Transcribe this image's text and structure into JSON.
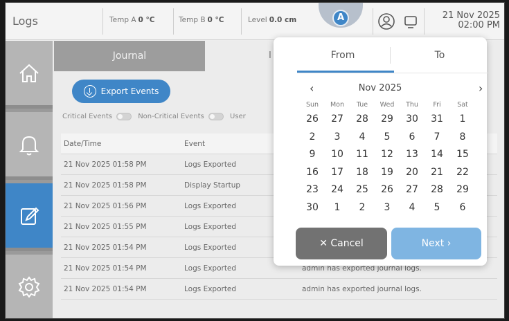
{
  "app": {
    "title": "Logs"
  },
  "sensors": [
    {
      "label": "Temp A",
      "value": "0 °C"
    },
    {
      "label": "Temp B",
      "value": "0 °C"
    },
    {
      "label": "Level",
      "value": "0.0 cm"
    }
  ],
  "user_badge": "A",
  "datetime": {
    "date": "21 Nov 2025",
    "time": "02:00 PM"
  },
  "icons": {
    "sidebar": [
      "home-icon",
      "bell-icon",
      "edit-icon",
      "gear-icon"
    ],
    "top": [
      "user-icon",
      "display-icon"
    ]
  },
  "colors": {
    "accent": "#3f86c7",
    "cancel": "#727272",
    "next": "#7fb5e2"
  },
  "tabs": {
    "journal": "Journal",
    "other": "I"
  },
  "export_button": "Export Events",
  "filters": [
    "Critical Events",
    "Non-Critical Events",
    "User"
  ],
  "table": {
    "headers": [
      "Date/Time",
      "Event",
      ""
    ],
    "rows": [
      {
        "datetime": "21 Nov 2025 01:58 PM",
        "event": "Logs Exported",
        "details": ""
      },
      {
        "datetime": "21 Nov 2025 01:58 PM",
        "event": "Display Startup",
        "details": ""
      },
      {
        "datetime": "21 Nov 2025 01:56 PM",
        "event": "Logs Exported",
        "details": ""
      },
      {
        "datetime": "21 Nov 2025 01:55 PM",
        "event": "Logs Exported",
        "details": ""
      },
      {
        "datetime": "21 Nov 2025 01:54 PM",
        "event": "Logs Exported",
        "details": ""
      },
      {
        "datetime": "21 Nov 2025 01:54 PM",
        "event": "Logs Exported",
        "details": "admin has exported journal logs."
      },
      {
        "datetime": "21 Nov 2025 01:54 PM",
        "event": "Logs Exported",
        "details": "admin has exported journal logs."
      }
    ]
  },
  "date_picker": {
    "tab_from": "From",
    "tab_to": "To",
    "prev": "‹",
    "next_arrow": "›",
    "month": "Nov 2025",
    "weekdays": [
      "Sun",
      "Mon",
      "Tue",
      "Wed",
      "Thu",
      "Fri",
      "Sat"
    ],
    "weeks": [
      [
        "26",
        "27",
        "28",
        "29",
        "30",
        "31",
        "1"
      ],
      [
        "2",
        "3",
        "4",
        "5",
        "6",
        "7",
        "8"
      ],
      [
        "9",
        "10",
        "11",
        "12",
        "13",
        "14",
        "15"
      ],
      [
        "16",
        "17",
        "18",
        "19",
        "20",
        "21",
        "22"
      ],
      [
        "23",
        "24",
        "25",
        "26",
        "27",
        "28",
        "29"
      ],
      [
        "30",
        "1",
        "2",
        "3",
        "4",
        "5",
        "6"
      ]
    ],
    "cancel": "✕ Cancel",
    "next": "Next ›"
  }
}
